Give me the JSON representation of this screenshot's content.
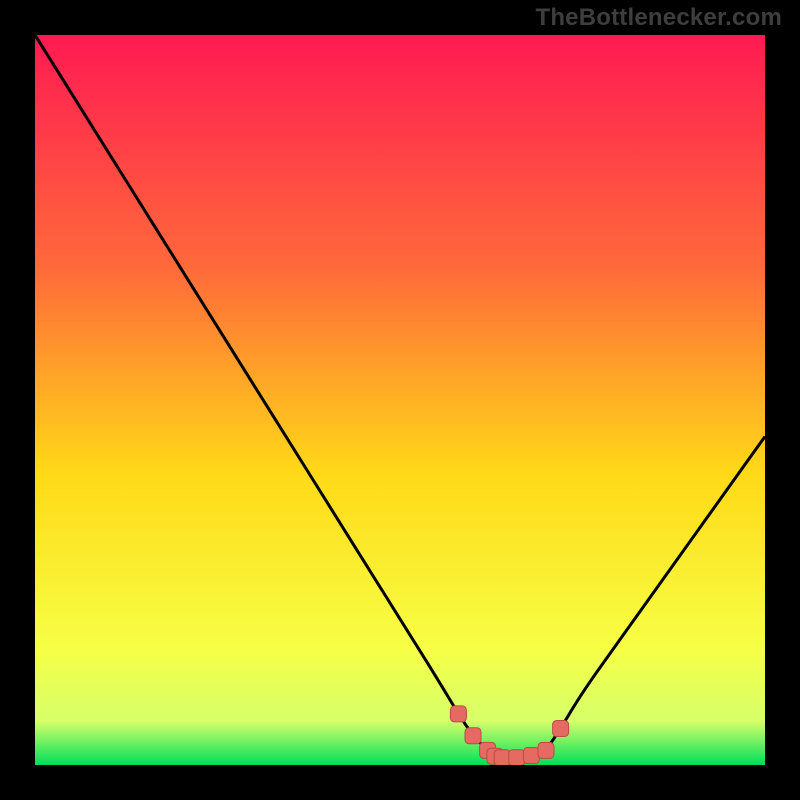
{
  "brand": {
    "watermark": "TheBottlenecker.com"
  },
  "colors": {
    "background": "#000000",
    "watermark_text": "#3e3e3e",
    "gradient_top": "#ff1a52",
    "gradient_upper_mid": "#ff6a3a",
    "gradient_mid": "#ffd917",
    "gradient_lower_mid": "#f6ff45",
    "gradient_near_bottom": "#d6ff6a",
    "gradient_bottom": "#00e05a",
    "curve": "#000000",
    "marker_fill": "#e46a62",
    "marker_stroke": "#b84d46"
  },
  "chart_data": {
    "type": "line",
    "title": "",
    "xlabel": "",
    "ylabel": "",
    "x": [
      0,
      5,
      10,
      15,
      20,
      25,
      30,
      35,
      40,
      45,
      50,
      55,
      58,
      60,
      62,
      63,
      64,
      66,
      68,
      70,
      72,
      75,
      80,
      85,
      90,
      95,
      100
    ],
    "values": [
      100,
      92,
      84,
      76,
      68,
      60,
      52,
      44,
      36,
      28,
      20,
      12,
      7,
      4,
      2,
      1.2,
      1,
      1,
      1.3,
      2,
      5,
      10,
      17,
      24,
      31,
      38,
      45
    ],
    "xlim": [
      0,
      100
    ],
    "ylim": [
      0,
      100
    ],
    "markers": [
      {
        "x": 58,
        "y": 7
      },
      {
        "x": 60,
        "y": 4
      },
      {
        "x": 62,
        "y": 2
      },
      {
        "x": 63,
        "y": 1.2
      },
      {
        "x": 64,
        "y": 1
      },
      {
        "x": 66,
        "y": 1
      },
      {
        "x": 68,
        "y": 1.3
      },
      {
        "x": 70,
        "y": 2
      },
      {
        "x": 72,
        "y": 5
      }
    ]
  }
}
